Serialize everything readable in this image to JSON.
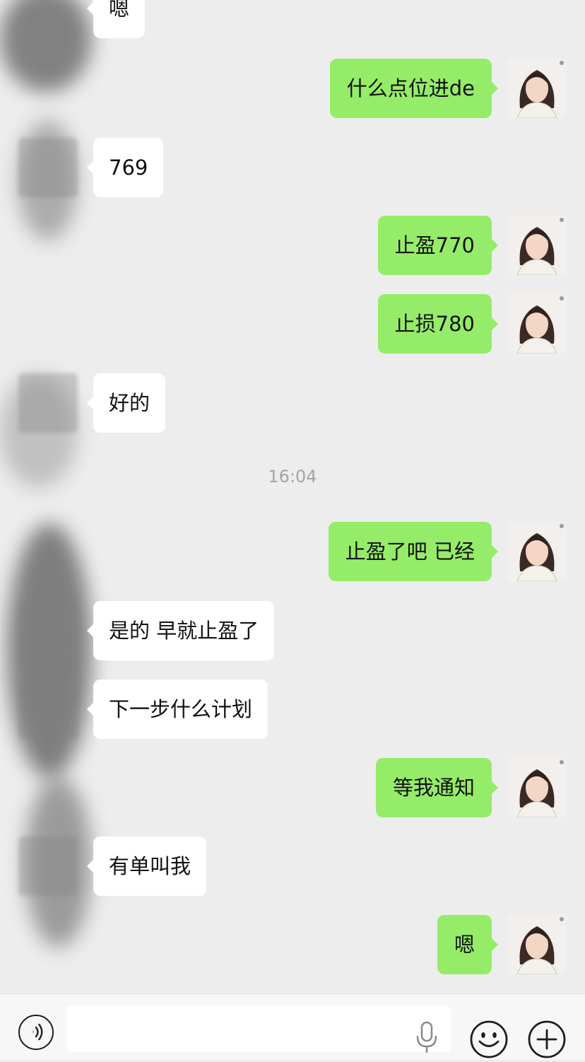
{
  "messages": [
    {
      "from": "other",
      "text": "嗯"
    },
    {
      "from": "self",
      "text": "什么点位进de"
    },
    {
      "from": "other",
      "text": "769"
    },
    {
      "from": "self",
      "text": "止盈770"
    },
    {
      "from": "self",
      "text": "止损780"
    },
    {
      "from": "other",
      "text": "好的"
    },
    {
      "from": "self",
      "text": "止盈了吧 已经"
    },
    {
      "from": "other",
      "text": "是的 早就止盈了"
    },
    {
      "from": "other",
      "text": "下一步什么计划"
    },
    {
      "from": "self",
      "text": "等我通知"
    },
    {
      "from": "other",
      "text": "有单叫我"
    },
    {
      "from": "self",
      "text": "嗯"
    }
  ],
  "timestamp": "16:04",
  "colors": {
    "background": "#ededed",
    "outgoing_bubble": "#95ec69",
    "incoming_bubble": "#ffffff",
    "timestamp_text": "#a4a4a4"
  },
  "icons": {
    "voice": "voice-icon",
    "microphone": "microphone-icon",
    "emoji": "emoji-icon",
    "more": "plus-icon"
  }
}
